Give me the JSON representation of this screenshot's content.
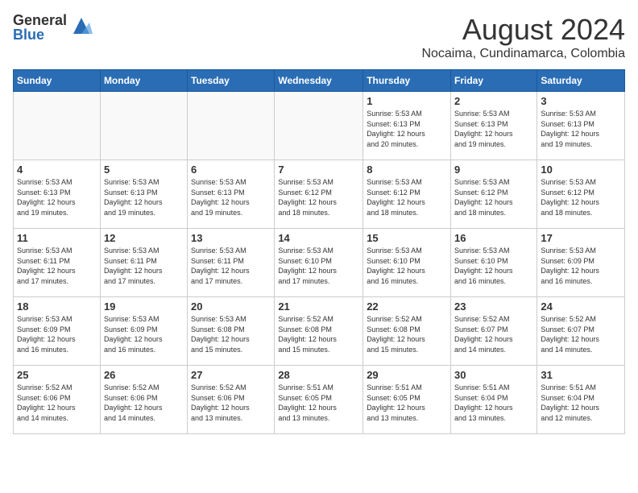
{
  "header": {
    "logo_general": "General",
    "logo_blue": "Blue",
    "title": "August 2024",
    "subtitle": "Nocaima, Cundinamarca, Colombia"
  },
  "calendar": {
    "days_of_week": [
      "Sunday",
      "Monday",
      "Tuesday",
      "Wednesday",
      "Thursday",
      "Friday",
      "Saturday"
    ],
    "weeks": [
      {
        "days": [
          {
            "num": "",
            "info": ""
          },
          {
            "num": "",
            "info": ""
          },
          {
            "num": "",
            "info": ""
          },
          {
            "num": "",
            "info": ""
          },
          {
            "num": "1",
            "info": "Sunrise: 5:53 AM\nSunset: 6:13 PM\nDaylight: 12 hours\nand 20 minutes."
          },
          {
            "num": "2",
            "info": "Sunrise: 5:53 AM\nSunset: 6:13 PM\nDaylight: 12 hours\nand 19 minutes."
          },
          {
            "num": "3",
            "info": "Sunrise: 5:53 AM\nSunset: 6:13 PM\nDaylight: 12 hours\nand 19 minutes."
          }
        ]
      },
      {
        "days": [
          {
            "num": "4",
            "info": "Sunrise: 5:53 AM\nSunset: 6:13 PM\nDaylight: 12 hours\nand 19 minutes."
          },
          {
            "num": "5",
            "info": "Sunrise: 5:53 AM\nSunset: 6:13 PM\nDaylight: 12 hours\nand 19 minutes."
          },
          {
            "num": "6",
            "info": "Sunrise: 5:53 AM\nSunset: 6:13 PM\nDaylight: 12 hours\nand 19 minutes."
          },
          {
            "num": "7",
            "info": "Sunrise: 5:53 AM\nSunset: 6:12 PM\nDaylight: 12 hours\nand 18 minutes."
          },
          {
            "num": "8",
            "info": "Sunrise: 5:53 AM\nSunset: 6:12 PM\nDaylight: 12 hours\nand 18 minutes."
          },
          {
            "num": "9",
            "info": "Sunrise: 5:53 AM\nSunset: 6:12 PM\nDaylight: 12 hours\nand 18 minutes."
          },
          {
            "num": "10",
            "info": "Sunrise: 5:53 AM\nSunset: 6:12 PM\nDaylight: 12 hours\nand 18 minutes."
          }
        ]
      },
      {
        "days": [
          {
            "num": "11",
            "info": "Sunrise: 5:53 AM\nSunset: 6:11 PM\nDaylight: 12 hours\nand 17 minutes."
          },
          {
            "num": "12",
            "info": "Sunrise: 5:53 AM\nSunset: 6:11 PM\nDaylight: 12 hours\nand 17 minutes."
          },
          {
            "num": "13",
            "info": "Sunrise: 5:53 AM\nSunset: 6:11 PM\nDaylight: 12 hours\nand 17 minutes."
          },
          {
            "num": "14",
            "info": "Sunrise: 5:53 AM\nSunset: 6:10 PM\nDaylight: 12 hours\nand 17 minutes."
          },
          {
            "num": "15",
            "info": "Sunrise: 5:53 AM\nSunset: 6:10 PM\nDaylight: 12 hours\nand 16 minutes."
          },
          {
            "num": "16",
            "info": "Sunrise: 5:53 AM\nSunset: 6:10 PM\nDaylight: 12 hours\nand 16 minutes."
          },
          {
            "num": "17",
            "info": "Sunrise: 5:53 AM\nSunset: 6:09 PM\nDaylight: 12 hours\nand 16 minutes."
          }
        ]
      },
      {
        "days": [
          {
            "num": "18",
            "info": "Sunrise: 5:53 AM\nSunset: 6:09 PM\nDaylight: 12 hours\nand 16 minutes."
          },
          {
            "num": "19",
            "info": "Sunrise: 5:53 AM\nSunset: 6:09 PM\nDaylight: 12 hours\nand 16 minutes."
          },
          {
            "num": "20",
            "info": "Sunrise: 5:53 AM\nSunset: 6:08 PM\nDaylight: 12 hours\nand 15 minutes."
          },
          {
            "num": "21",
            "info": "Sunrise: 5:52 AM\nSunset: 6:08 PM\nDaylight: 12 hours\nand 15 minutes."
          },
          {
            "num": "22",
            "info": "Sunrise: 5:52 AM\nSunset: 6:08 PM\nDaylight: 12 hours\nand 15 minutes."
          },
          {
            "num": "23",
            "info": "Sunrise: 5:52 AM\nSunset: 6:07 PM\nDaylight: 12 hours\nand 14 minutes."
          },
          {
            "num": "24",
            "info": "Sunrise: 5:52 AM\nSunset: 6:07 PM\nDaylight: 12 hours\nand 14 minutes."
          }
        ]
      },
      {
        "days": [
          {
            "num": "25",
            "info": "Sunrise: 5:52 AM\nSunset: 6:06 PM\nDaylight: 12 hours\nand 14 minutes."
          },
          {
            "num": "26",
            "info": "Sunrise: 5:52 AM\nSunset: 6:06 PM\nDaylight: 12 hours\nand 14 minutes."
          },
          {
            "num": "27",
            "info": "Sunrise: 5:52 AM\nSunset: 6:06 PM\nDaylight: 12 hours\nand 13 minutes."
          },
          {
            "num": "28",
            "info": "Sunrise: 5:51 AM\nSunset: 6:05 PM\nDaylight: 12 hours\nand 13 minutes."
          },
          {
            "num": "29",
            "info": "Sunrise: 5:51 AM\nSunset: 6:05 PM\nDaylight: 12 hours\nand 13 minutes."
          },
          {
            "num": "30",
            "info": "Sunrise: 5:51 AM\nSunset: 6:04 PM\nDaylight: 12 hours\nand 13 minutes."
          },
          {
            "num": "31",
            "info": "Sunrise: 5:51 AM\nSunset: 6:04 PM\nDaylight: 12 hours\nand 12 minutes."
          }
        ]
      }
    ]
  }
}
